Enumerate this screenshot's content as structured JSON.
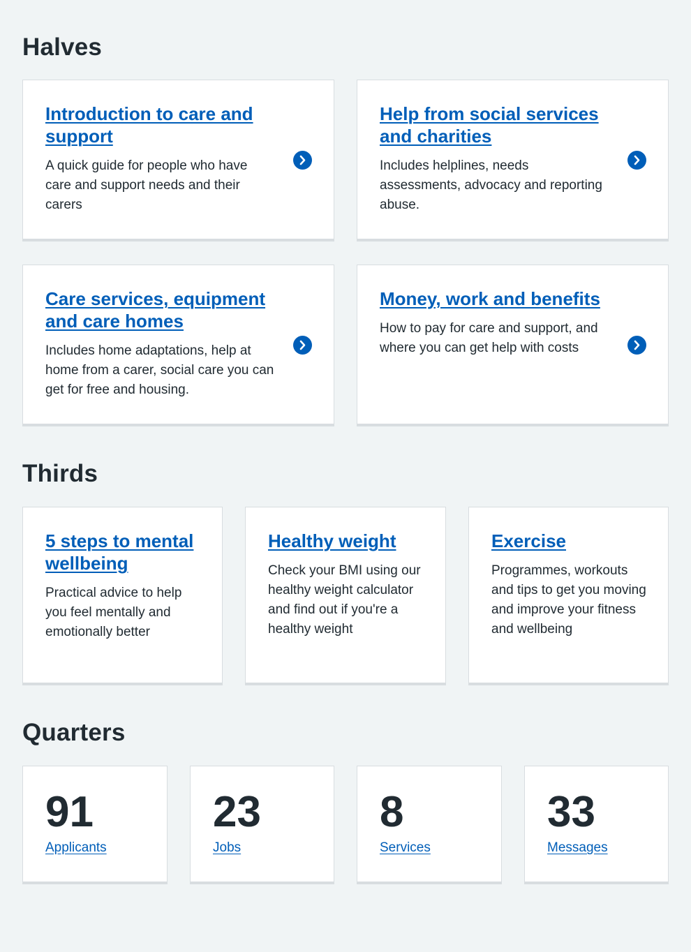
{
  "halves": {
    "heading": "Halves",
    "cards": [
      {
        "title": "Introduction to care and support",
        "description": "A quick guide for people who have care and support needs and their carers",
        "icon": "chevron-right-icon"
      },
      {
        "title": "Help from social services and charities",
        "description": "Includes helplines, needs assessments, advocacy and reporting abuse.",
        "icon": "chevron-right-icon"
      },
      {
        "title": "Care services, equipment and care homes",
        "description": "Includes home adaptations, help at home from a carer, social care you can get for free and housing.",
        "icon": "chevron-right-icon"
      },
      {
        "title": "Money, work and benefits",
        "description": "How to pay for care and support, and where you can get help with costs",
        "icon": "chevron-right-icon"
      }
    ]
  },
  "thirds": {
    "heading": "Thirds",
    "cards": [
      {
        "title": "5 steps to mental wellbeing",
        "description": "Practical advice to help you feel mentally and emotionally better"
      },
      {
        "title": "Healthy weight",
        "description": "Check your BMI using our healthy weight calculator and find out if you're a healthy weight"
      },
      {
        "title": "Exercise",
        "description": "Programmes, workouts and tips to get you moving and improve your fitness and wellbeing"
      }
    ]
  },
  "quarters": {
    "heading": "Quarters",
    "cards": [
      {
        "number": "91",
        "label": "Applicants"
      },
      {
        "number": "23",
        "label": "Jobs"
      },
      {
        "number": "8",
        "label": "Services"
      },
      {
        "number": "33",
        "label": "Messages"
      }
    ]
  },
  "colors": {
    "background": "#f0f4f5",
    "link": "#005eb8",
    "text": "#212b32",
    "card_border": "#d8dde0"
  }
}
